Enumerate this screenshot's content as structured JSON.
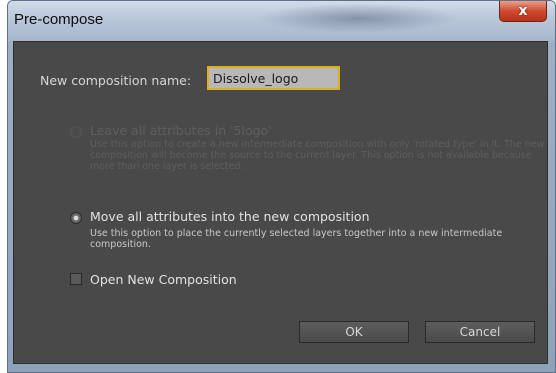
{
  "dialog": {
    "title": "Pre-compose",
    "close_label": "x"
  },
  "name_field": {
    "label": "New composition name:",
    "value": "Dissolve_logo"
  },
  "option_leave": {
    "label": "Leave all attributes in '5logo'",
    "description": "Use this option to create a new intermediate composition with only 'rotated type' in it. The new composition will become the source to the current layer. This option is not available because more than one layer is selected.",
    "enabled": false
  },
  "option_move": {
    "label": "Move all attributes into the new composition",
    "description": "Use this option to place the currently selected layers together into a new intermediate composition.",
    "selected": true
  },
  "open_new": {
    "label": "Open New Composition",
    "checked": false
  },
  "buttons": {
    "ok": "OK",
    "cancel": "Cancel"
  }
}
